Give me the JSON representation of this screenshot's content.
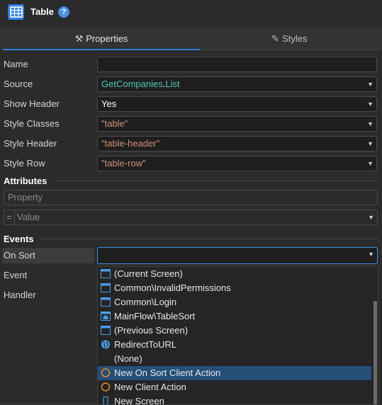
{
  "header": {
    "title": "Table",
    "help": "?"
  },
  "tabs": [
    {
      "label": "Properties",
      "icon": "wrench-icon",
      "active": true
    },
    {
      "label": "Styles",
      "icon": "brush-icon",
      "active": false
    }
  ],
  "properties": [
    {
      "label": "Name",
      "value": ""
    },
    {
      "label": "Source",
      "value_prefix": "GetCompanies",
      "value_dot": ".",
      "value_suffix": "List"
    },
    {
      "label": "Show Header",
      "value": "Yes"
    },
    {
      "label": "Style Classes",
      "value": "\"table\""
    },
    {
      "label": "Style Header",
      "value": "\"table-header\""
    },
    {
      "label": "Style Row",
      "value": "\"table-row\""
    }
  ],
  "attributes": {
    "title": "Attributes",
    "property_placeholder": "Property",
    "eq": "=",
    "value_placeholder": "Value"
  },
  "events": {
    "title": "Events",
    "on_sort": "On Sort",
    "event": "Event",
    "handler": "Handler",
    "on_sort_value": ""
  },
  "dropdown": {
    "items": [
      {
        "label": "(Current Screen)",
        "icon": "screen-icon"
      },
      {
        "label": "Common\\InvalidPermissions",
        "icon": "screen-icon"
      },
      {
        "label": "Common\\Login",
        "icon": "screen-icon"
      },
      {
        "label": "MainFlow\\TableSort",
        "icon": "home-screen-icon"
      },
      {
        "label": "(Previous Screen)",
        "icon": "screen-icon"
      },
      {
        "label": "RedirectToURL",
        "icon": "globe-icon"
      },
      {
        "label": "(None)",
        "icon": ""
      },
      {
        "label": "New On Sort Client Action",
        "icon": "client-action-icon",
        "selected": true
      },
      {
        "label": "New Client Action",
        "icon": "client-action-icon"
      },
      {
        "label": "New Screen",
        "icon": "mobile-screen-icon"
      }
    ]
  },
  "colors": {
    "accent": "#2f7fd6",
    "selection": "#264f78",
    "teal": "#4ec9b0",
    "string": "#ce9178",
    "client_action": "#e8912d"
  }
}
